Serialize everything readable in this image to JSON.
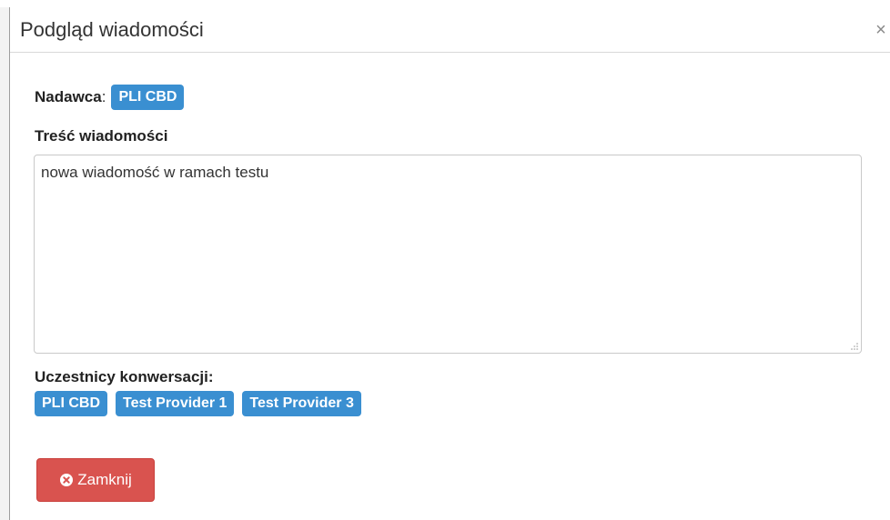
{
  "modal": {
    "title": "Podgląd wiadomości",
    "close_symbol": "×"
  },
  "sender": {
    "label": "Nadawca",
    "colon": ":",
    "value": "PLI CBD"
  },
  "content": {
    "label": "Treść wiadomości",
    "message": "nowa wiadomość w ramach testu"
  },
  "participants": {
    "label": "Uczestnicy konwersacji:",
    "items": [
      "PLI CBD",
      "Test Provider 1",
      "Test Provider 3"
    ]
  },
  "footer": {
    "close_label": "Zamknij",
    "close_icon": "times-circle-icon"
  },
  "colors": {
    "tag": "#3a8fd1",
    "danger": "#d9534f"
  }
}
